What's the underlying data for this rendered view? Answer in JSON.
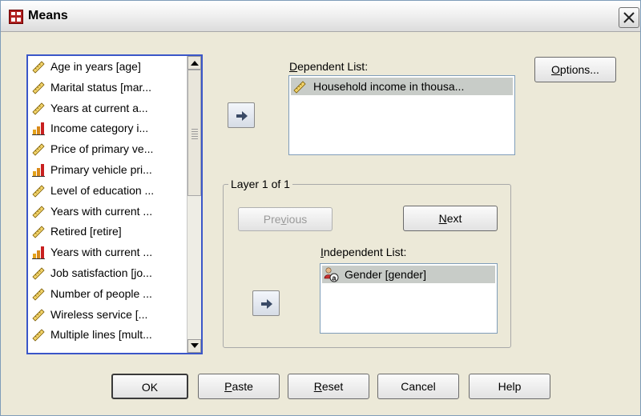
{
  "window": {
    "title": "Means"
  },
  "variables": [
    {
      "label": "Age in years [age]",
      "icon": "ruler-scale-icon"
    },
    {
      "label": "Marital status [mar...",
      "icon": "ruler-scale-icon"
    },
    {
      "label": "Years at current a...",
      "icon": "ruler-scale-icon"
    },
    {
      "label": "Income category i...",
      "icon": "bar-ordinal-icon"
    },
    {
      "label": "Price of primary ve...",
      "icon": "ruler-scale-icon"
    },
    {
      "label": "Primary vehicle pri...",
      "icon": "bar-ordinal-icon"
    },
    {
      "label": "Level of education ...",
      "icon": "ruler-scale-icon"
    },
    {
      "label": "Years with current ...",
      "icon": "ruler-scale-icon"
    },
    {
      "label": "Retired [retire]",
      "icon": "ruler-scale-icon"
    },
    {
      "label": "Years with current ...",
      "icon": "bar-ordinal-icon"
    },
    {
      "label": "Job satisfaction [jo...",
      "icon": "ruler-scale-icon"
    },
    {
      "label": "Number of people ...",
      "icon": "ruler-scale-icon"
    },
    {
      "label": "Wireless service [...",
      "icon": "ruler-scale-icon"
    },
    {
      "label": "Multiple lines [mult...",
      "icon": "ruler-scale-icon"
    }
  ],
  "dependent": {
    "label_prefix": "",
    "label_key": "D",
    "label_rest": "ependent List:",
    "items": [
      "Household income in thousa..."
    ]
  },
  "layer": {
    "title": "Layer 1 of 1",
    "previous": {
      "pre": "Pre",
      "key": "v",
      "post": "ious"
    },
    "next": {
      "key": "N",
      "post": "ext"
    }
  },
  "independent": {
    "label_key": "I",
    "label_rest": "ndependent List:",
    "items": [
      "Gender [gender]"
    ]
  },
  "buttons": {
    "options": {
      "key": "O",
      "post": "ptions..."
    },
    "ok": "OK",
    "paste": {
      "key": "P",
      "post": "aste"
    },
    "reset": {
      "key": "R",
      "post": "eset"
    },
    "cancel": "Cancel",
    "help": "Help"
  },
  "colors": {
    "accent_border": "#3a56c8",
    "dialog_bg": "#ece9d8",
    "selection": "#c8ccc8"
  }
}
